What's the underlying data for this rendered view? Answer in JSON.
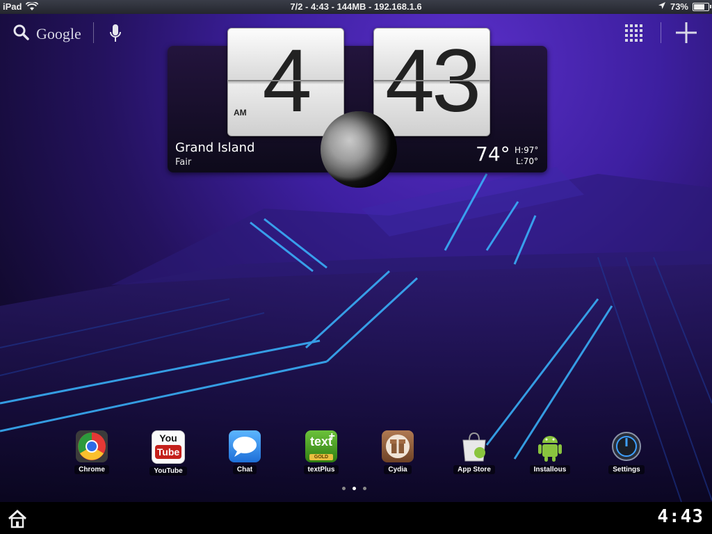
{
  "status_bar": {
    "device": "iPad",
    "center_text": "7/2 - 4:43 - 144MB - 192.168.1.6",
    "battery_percent": "73%",
    "battery_level": 0.73,
    "icons": [
      "wifi-icon",
      "location-arrow-icon",
      "battery-icon"
    ]
  },
  "search": {
    "label": "Google",
    "icons": [
      "search-icon",
      "microphone-icon"
    ]
  },
  "toolbar": {
    "icons": [
      "app-grid-icon",
      "add-icon"
    ]
  },
  "clock": {
    "hour": "4",
    "minute": "43",
    "ampm": "AM"
  },
  "weather": {
    "city": "Grand Island",
    "condition": "Fair",
    "temp": "74°",
    "high": "H:97°",
    "low": "L:70°",
    "icon": "moon-icon"
  },
  "dock": {
    "apps": [
      {
        "label": "Chrome",
        "icon": "chrome-icon"
      },
      {
        "label": "YouTube",
        "icon": "youtube-icon",
        "icon_text_top": "You",
        "icon_text_bottom": "Tube"
      },
      {
        "label": "Chat",
        "icon": "chat-icon"
      },
      {
        "label": "textPlus",
        "icon": "textplus-icon",
        "icon_text": "text",
        "icon_sub": "GOLD"
      },
      {
        "label": "Cydia",
        "icon": "cydia-icon"
      },
      {
        "label": "App Store",
        "icon": "app-store-icon"
      },
      {
        "label": "Installous",
        "icon": "android-icon"
      },
      {
        "label": "Settings",
        "icon": "settings-icon"
      }
    ],
    "pages": 3,
    "active_page": 2
  },
  "system_bar": {
    "clock": "4:43",
    "icons": [
      "home-icon"
    ]
  },
  "colors": {
    "wallpaper_accent": "#3d1fa0",
    "line_accent": "#2aa8ff",
    "youtube_red": "#c4201b",
    "textplus_green": "#4a9a1e",
    "android_green": "#8ac43f"
  }
}
